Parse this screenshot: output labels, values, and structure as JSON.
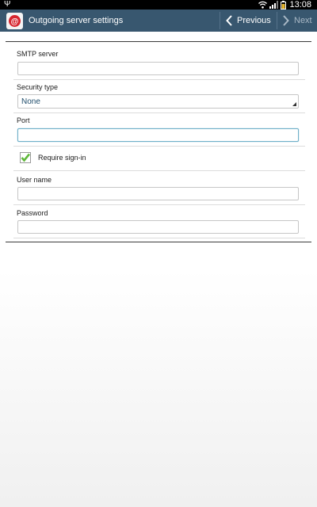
{
  "status_bar": {
    "usb_icon": "usb-icon",
    "wifi_icon": "wifi-icon",
    "signal_icon": "signal-icon",
    "battery_icon": "battery-icon",
    "time": "13:08"
  },
  "action_bar": {
    "app_icon": "email-app-icon",
    "title": "Outgoing server settings",
    "previous_label": "Previous",
    "next_label": "Next",
    "background_color": "#38576f"
  },
  "form": {
    "smtp_server": {
      "label": "SMTP server",
      "value": "",
      "placeholder": ""
    },
    "security_type": {
      "label": "Security type",
      "value": "None"
    },
    "port": {
      "label": "Port",
      "value": "",
      "placeholder": ""
    },
    "require_signin": {
      "label": "Require sign-in",
      "checked": true,
      "check_color": "#5fb83a"
    },
    "user_name": {
      "label": "User name",
      "value": "",
      "placeholder": ""
    },
    "password": {
      "label": "Password",
      "value": "",
      "placeholder": ""
    }
  }
}
